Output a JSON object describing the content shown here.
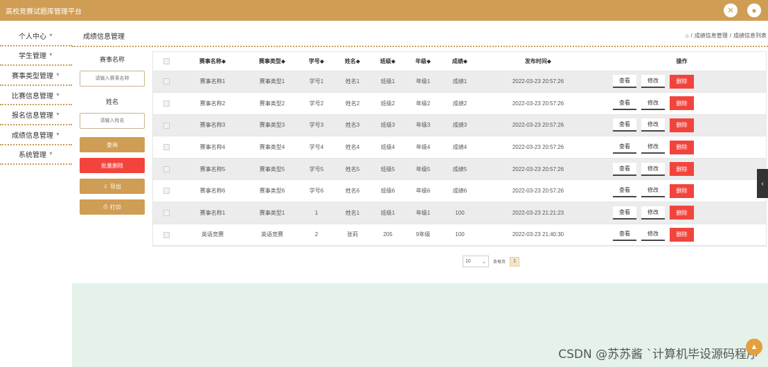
{
  "app": {
    "title": "高校竞赛试题库管理平台"
  },
  "header_icons": [
    "close-icon",
    "user-icon"
  ],
  "sidebar": {
    "items": [
      {
        "label": "个人中心"
      },
      {
        "label": "学生管理"
      },
      {
        "label": "赛事类型管理"
      },
      {
        "label": "比赛信息管理"
      },
      {
        "label": "报名信息管理"
      },
      {
        "label": "成绩信息管理"
      },
      {
        "label": "系统管理"
      }
    ]
  },
  "page": {
    "title": "成绩信息管理",
    "breadcrumb": [
      "成绩信息管理",
      "成绩信息列表"
    ]
  },
  "filters": {
    "event_name_label": "赛事名称",
    "event_name_placeholder": "请输入赛事名称",
    "name_label": "姓名",
    "name_placeholder": "请输入姓名",
    "query_button": "查询",
    "batch_delete_button": "批量删除",
    "export_button": "导出",
    "print_button": "打印"
  },
  "table": {
    "headers": [
      "赛事名称◆",
      "赛事类型◆",
      "学号◆",
      "姓名◆",
      "班级◆",
      "年级◆",
      "成绩◆",
      "发布时间◆",
      "操作"
    ],
    "actions": {
      "view": "查看",
      "edit": "修改",
      "delete": "删除"
    },
    "rows": [
      [
        "赛事名称1",
        "赛事类型1",
        "学号1",
        "姓名1",
        "班级1",
        "年级1",
        "成绩1",
        "2022-03-23 20:57:26"
      ],
      [
        "赛事名称2",
        "赛事类型2",
        "学号2",
        "姓名2",
        "班级2",
        "年级2",
        "成绩2",
        "2022-03-23 20:57:26"
      ],
      [
        "赛事名称3",
        "赛事类型3",
        "学号3",
        "姓名3",
        "班级3",
        "年级3",
        "成绩3",
        "2022-03-23 20:57:26"
      ],
      [
        "赛事名称4",
        "赛事类型4",
        "学号4",
        "姓名4",
        "班级4",
        "年级4",
        "成绩4",
        "2022-03-23 20:57:26"
      ],
      [
        "赛事名称5",
        "赛事类型5",
        "学号5",
        "姓名5",
        "班级5",
        "年级5",
        "成绩5",
        "2022-03-23 20:57:26"
      ],
      [
        "赛事名称6",
        "赛事类型6",
        "学号6",
        "姓名6",
        "班级6",
        "年级6",
        "成绩6",
        "2022-03-23 20:57:26"
      ],
      [
        "赛事名称1",
        "赛事类型1",
        "1",
        "姓名1",
        "班级1",
        "年级1",
        "100",
        "2022-03-23 21:21:23"
      ],
      [
        "英语竞赛",
        "英语竞赛",
        "2",
        "张莉",
        "205",
        "9年级",
        "100",
        "2022-03-23 21:40:30"
      ]
    ]
  },
  "pagination": {
    "page_size": "10",
    "per_page_label": "条每页",
    "current_page": "1"
  },
  "colors": {
    "primary": "#cf9d54",
    "danger": "#f2443d",
    "batch_delete": "#f2443d",
    "footer": "#e4f2ea"
  },
  "watermark": "CSDN @苏苏酱 `计算机毕设源码程序"
}
